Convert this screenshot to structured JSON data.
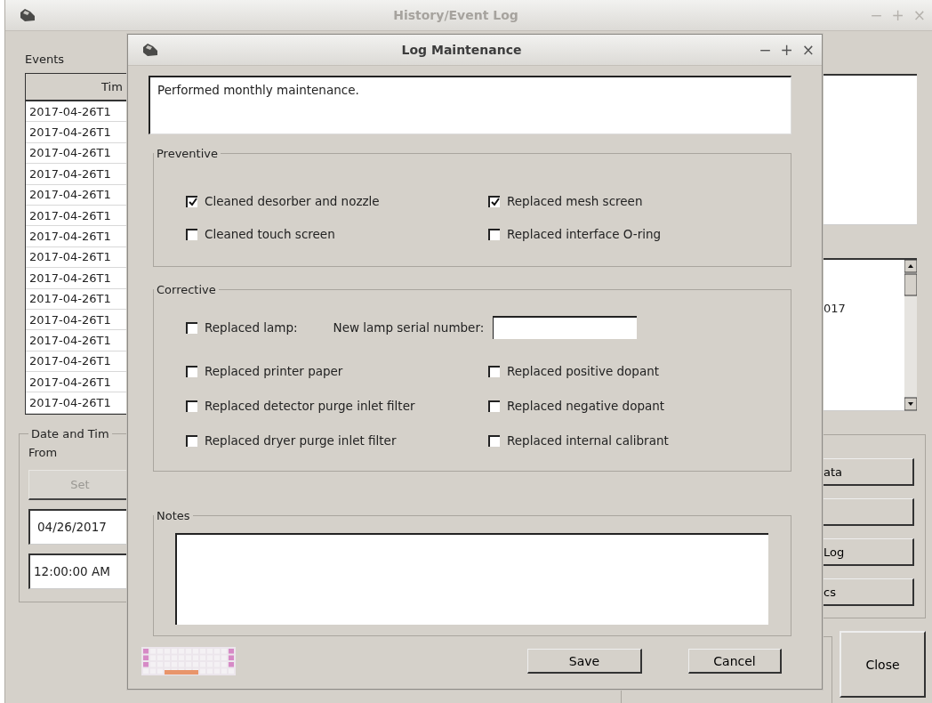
{
  "main_window": {
    "title": "History/Event Log",
    "active": false,
    "controls": [
      "−",
      "+",
      "×"
    ],
    "events": {
      "label": "Events",
      "column_1": "Tim",
      "rows": [
        "2017-04-26T1",
        "2017-04-26T1",
        "2017-04-26T1",
        "2017-04-26T1",
        "2017-04-26T1",
        "2017-04-26T1",
        "2017-04-26T1",
        "2017-04-26T1",
        "2017-04-26T1",
        "2017-04-26T1",
        "2017-04-26T1",
        "2017-04-26T1",
        "2017-04-26T1",
        "2017-04-26T1",
        "2017-04-26T1"
      ]
    },
    "date_time": {
      "label": "Date and Tim",
      "from_label": "From",
      "set_button": {
        "label": "Set",
        "disabled": true
      },
      "date": "04/26/2017",
      "time": "12:00:00 AM"
    },
    "detail_text": "017",
    "action_buttons": [
      {
        "kind": "text",
        "label": "ata"
      },
      {
        "kind": "blank"
      },
      {
        "kind": "text",
        "label": "Log"
      },
      {
        "kind": "text",
        "label": "cs"
      }
    ],
    "close_button": "Close"
  },
  "dialog": {
    "title": "Log Maintenance",
    "controls": [
      "−",
      "+",
      "×"
    ],
    "description": "Performed monthly maintenance.",
    "preventive": {
      "label": "Preventive",
      "items": [
        {
          "label": "Cleaned desorber and nozzle",
          "checked": true
        },
        {
          "label": "Replaced mesh screen",
          "checked": true
        },
        {
          "label": "Cleaned touch screen",
          "checked": false
        },
        {
          "label": "Replaced interface O-ring",
          "checked": false
        }
      ]
    },
    "corrective": {
      "label": "Corrective",
      "lamp": {
        "label": "Replaced lamp:",
        "checked": false,
        "serial_label": "New lamp serial number:"
      },
      "items": [
        {
          "label": "Replaced printer paper",
          "checked": false
        },
        {
          "label": "Replaced positive dopant",
          "checked": false
        },
        {
          "label": "Replaced detector purge inlet filter",
          "checked": false
        },
        {
          "label": "Replaced negative dopant",
          "checked": false
        },
        {
          "label": "Replaced dryer purge inlet filter",
          "checked": false
        },
        {
          "label": "Replaced internal calibrant",
          "checked": false
        }
      ]
    },
    "notes": {
      "label": "Notes"
    },
    "buttons": [
      "Save",
      "Cancel"
    ]
  }
}
